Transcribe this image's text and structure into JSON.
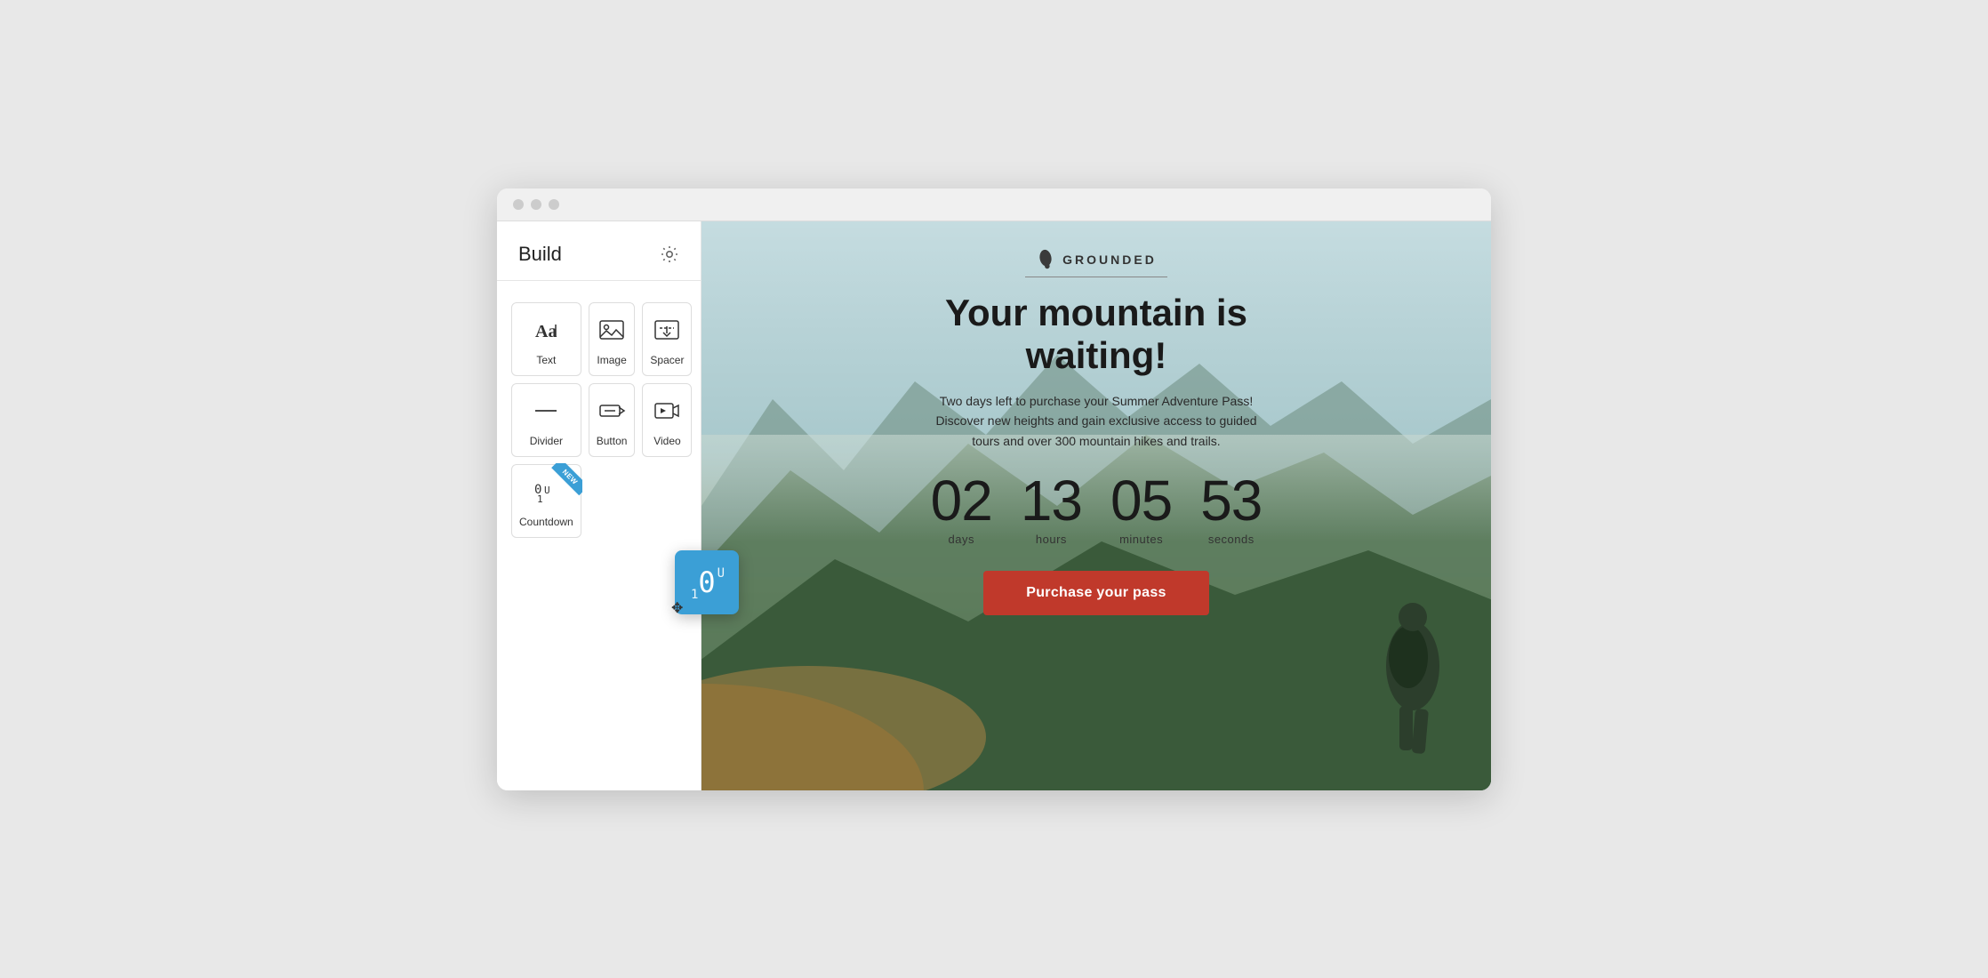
{
  "sidebar": {
    "title": "Build",
    "gear_label": "settings",
    "blocks": [
      {
        "id": "text",
        "label": "Text",
        "icon": "text-icon"
      },
      {
        "id": "image",
        "label": "Image",
        "icon": "image-icon"
      },
      {
        "id": "spacer",
        "label": "Spacer",
        "icon": "spacer-icon"
      },
      {
        "id": "divider",
        "label": "Divider",
        "icon": "divider-icon"
      },
      {
        "id": "button",
        "label": "Button",
        "icon": "button-icon"
      },
      {
        "id": "video",
        "label": "Video",
        "icon": "video-icon"
      },
      {
        "id": "countdown",
        "label": "Countdown",
        "icon": "countdown-icon",
        "badge": "NEW"
      }
    ]
  },
  "drag_element": {
    "visible": true
  },
  "preview": {
    "logo": {
      "text": "GROUNDED"
    },
    "hero": {
      "title": "Your mountain is waiting!",
      "subtitle": "Two days left to purchase your Summer Adventure Pass! Discover new heights and gain exclusive access to guided tours and over 300 mountain hikes and trails."
    },
    "countdown": {
      "days": {
        "value": "02",
        "label": "days"
      },
      "hours": {
        "value": "13",
        "label": "hours"
      },
      "minutes": {
        "value": "05",
        "label": "minutes"
      },
      "seconds": {
        "value": "53",
        "label": "seconds"
      }
    },
    "cta": {
      "label": "Purchase your pass"
    }
  }
}
